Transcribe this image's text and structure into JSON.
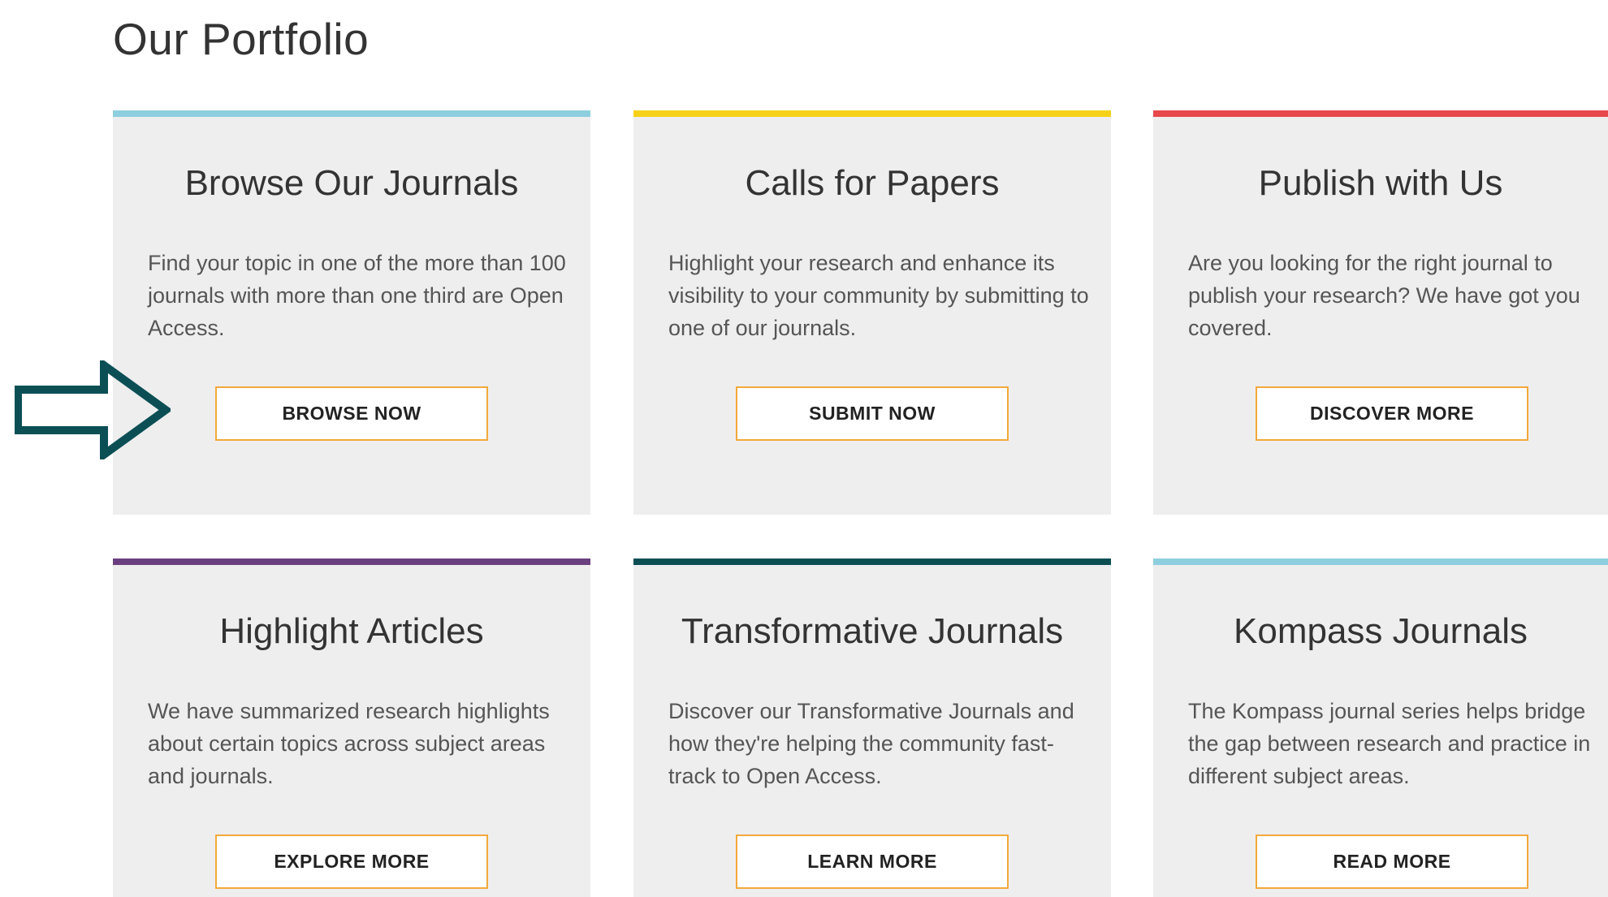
{
  "page": {
    "title": "Our Portfolio"
  },
  "cards": [
    {
      "title": "Browse Our Journals",
      "text": "Find your topic in one of the more than 100 journals with more than one third are Open Access.",
      "button": "BROWSE NOW",
      "accent": "#8ecfdf"
    },
    {
      "title": "Calls for Papers",
      "text": "Highlight your research and enhance its visibility to your community by submitting to one of our journals.",
      "button": "SUBMIT NOW",
      "accent": "#f7d117"
    },
    {
      "title": "Publish with Us",
      "text": "Are you looking for the right journal to publish your research? We have got you covered.",
      "button": "DISCOVER MORE",
      "accent": "#e8474b"
    },
    {
      "title": "Highlight Articles",
      "text": "We have summarized research highlights about certain topics across subject areas and journals.",
      "button": "EXPLORE MORE",
      "accent": "#6b3f7f"
    },
    {
      "title": "Transformative Journals",
      "text": "Discover our Transformative Journals and how they're helping the community fast-track to Open Access.",
      "button": "LEARN MORE",
      "accent": "#0b4f55"
    },
    {
      "title": "Kompass Journals",
      "text": "The Kompass journal series helps bridge the gap between research and practice in different subject areas.",
      "button": "READ MORE",
      "accent": "#8ecfdf"
    }
  ],
  "colors": {
    "card_background": "#eeeeee",
    "button_border": "#f2a93b",
    "arrow": "#0b4f55"
  },
  "icons": {
    "pointer": "right-arrow-outline-icon"
  }
}
